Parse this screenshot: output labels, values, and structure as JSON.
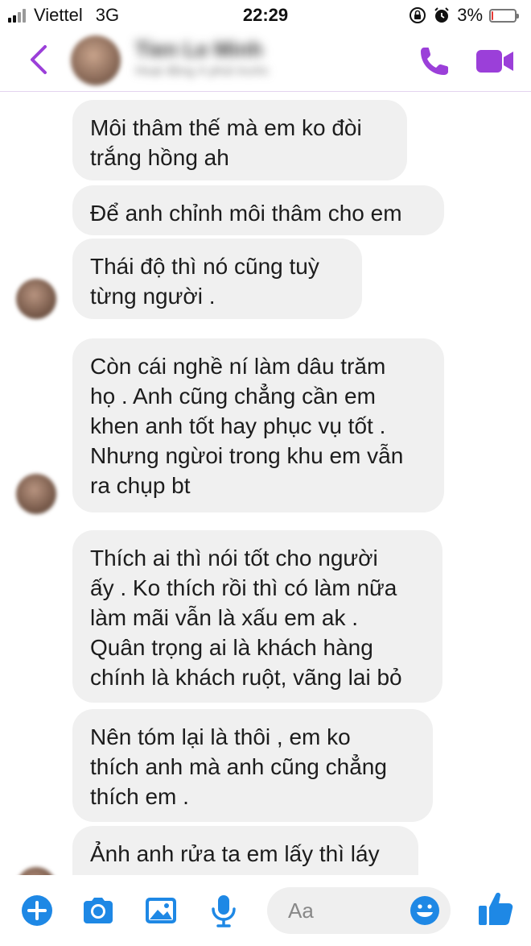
{
  "status_bar": {
    "carrier": "Viettel",
    "network": "3G",
    "time": "22:29",
    "battery_percent": "3%",
    "battery_level": 0.03
  },
  "header": {
    "contact_name": "Tien Le Minh",
    "contact_status": "Hoạt động 4 phút trước",
    "accent_color": "#9b3fd9"
  },
  "messages": [
    {
      "text": "Môi thâm thế mà em ko đòi\ntrắng hồng ah"
    },
    {
      "text": "Để anh chỉnh môi thâm cho em"
    },
    {
      "text": "Thái độ thì nó cũng tuỳ\ntừng người ."
    },
    {
      "text": "Còn cái nghề ní làm dâu trăm\nhọ . Anh cũng chẳng cần em\nkhen anh tốt hay phục vụ tốt .\nNhưng ngừoi trong khu em vẫn\nra chụp bt"
    },
    {
      "text": "Thích ai thì nói tốt cho người\nấy . Ko thích rồi thì có làm nữa\nlàm mãi vẫn là xấu em ak .\nQuân trọng ai là khách hàng\nchính là khách ruột, vãng lai bỏ"
    },
    {
      "text": "Nên tóm lại là thôi , em ko\nthích anh mà anh cũng chẳng\nthích em ."
    },
    {
      "text": "Ảnh anh rửa ta em lấy thì láy"
    }
  ],
  "composer": {
    "placeholder": "Aa"
  },
  "icons": [
    "back-icon",
    "phone-icon",
    "video-icon",
    "plus-icon",
    "camera-icon",
    "image-icon",
    "mic-icon",
    "emoji-icon",
    "thumbs-up-icon"
  ]
}
